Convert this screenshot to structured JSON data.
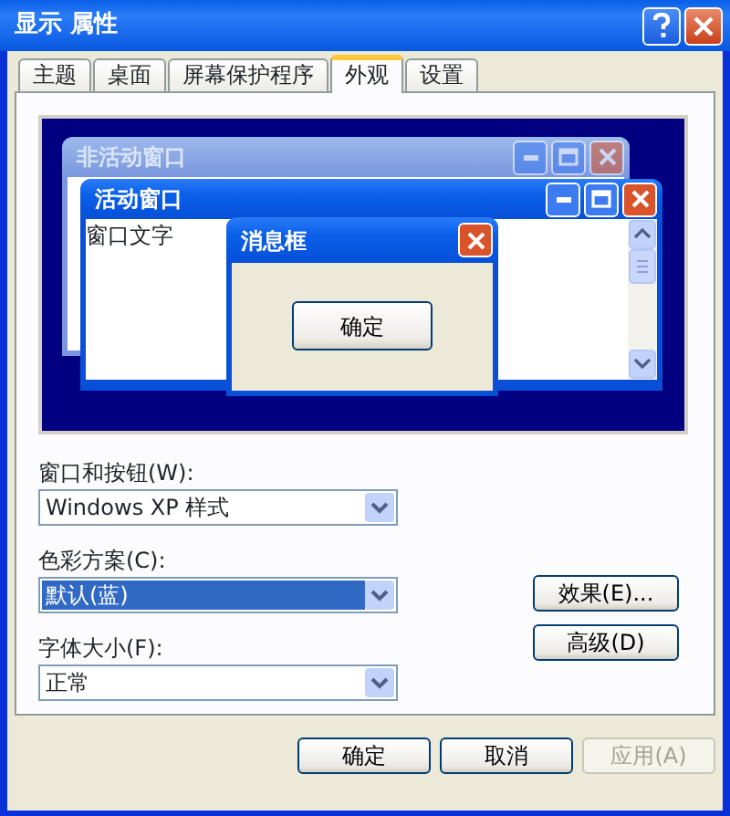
{
  "window": {
    "title": "显示 属性"
  },
  "tabs": [
    {
      "label": "主题",
      "selected": false
    },
    {
      "label": "桌面",
      "selected": false
    },
    {
      "label": "屏幕保护程序",
      "selected": false
    },
    {
      "label": "外观",
      "selected": true
    },
    {
      "label": "设置",
      "selected": false
    }
  ],
  "preview": {
    "inactive_window": {
      "title": "非活动窗口"
    },
    "active_window": {
      "title": "活动窗口",
      "text": "窗口文字"
    },
    "message_box": {
      "title": "消息框",
      "button": "确定"
    }
  },
  "fields": [
    {
      "label": "窗口和按钮(W):",
      "value": "Windows XP 样式",
      "highlighted": false
    },
    {
      "label": "色彩方案(C):",
      "value": "默认(蓝)",
      "highlighted": true
    },
    {
      "label": "字体大小(F):",
      "value": "正常",
      "highlighted": false
    }
  ],
  "side_buttons": [
    "效果(E)...",
    "高级(D)"
  ],
  "buttons": [
    {
      "label": "确定",
      "disabled": false
    },
    {
      "label": "取消",
      "disabled": false
    },
    {
      "label": "应用(A)",
      "disabled": true
    }
  ]
}
